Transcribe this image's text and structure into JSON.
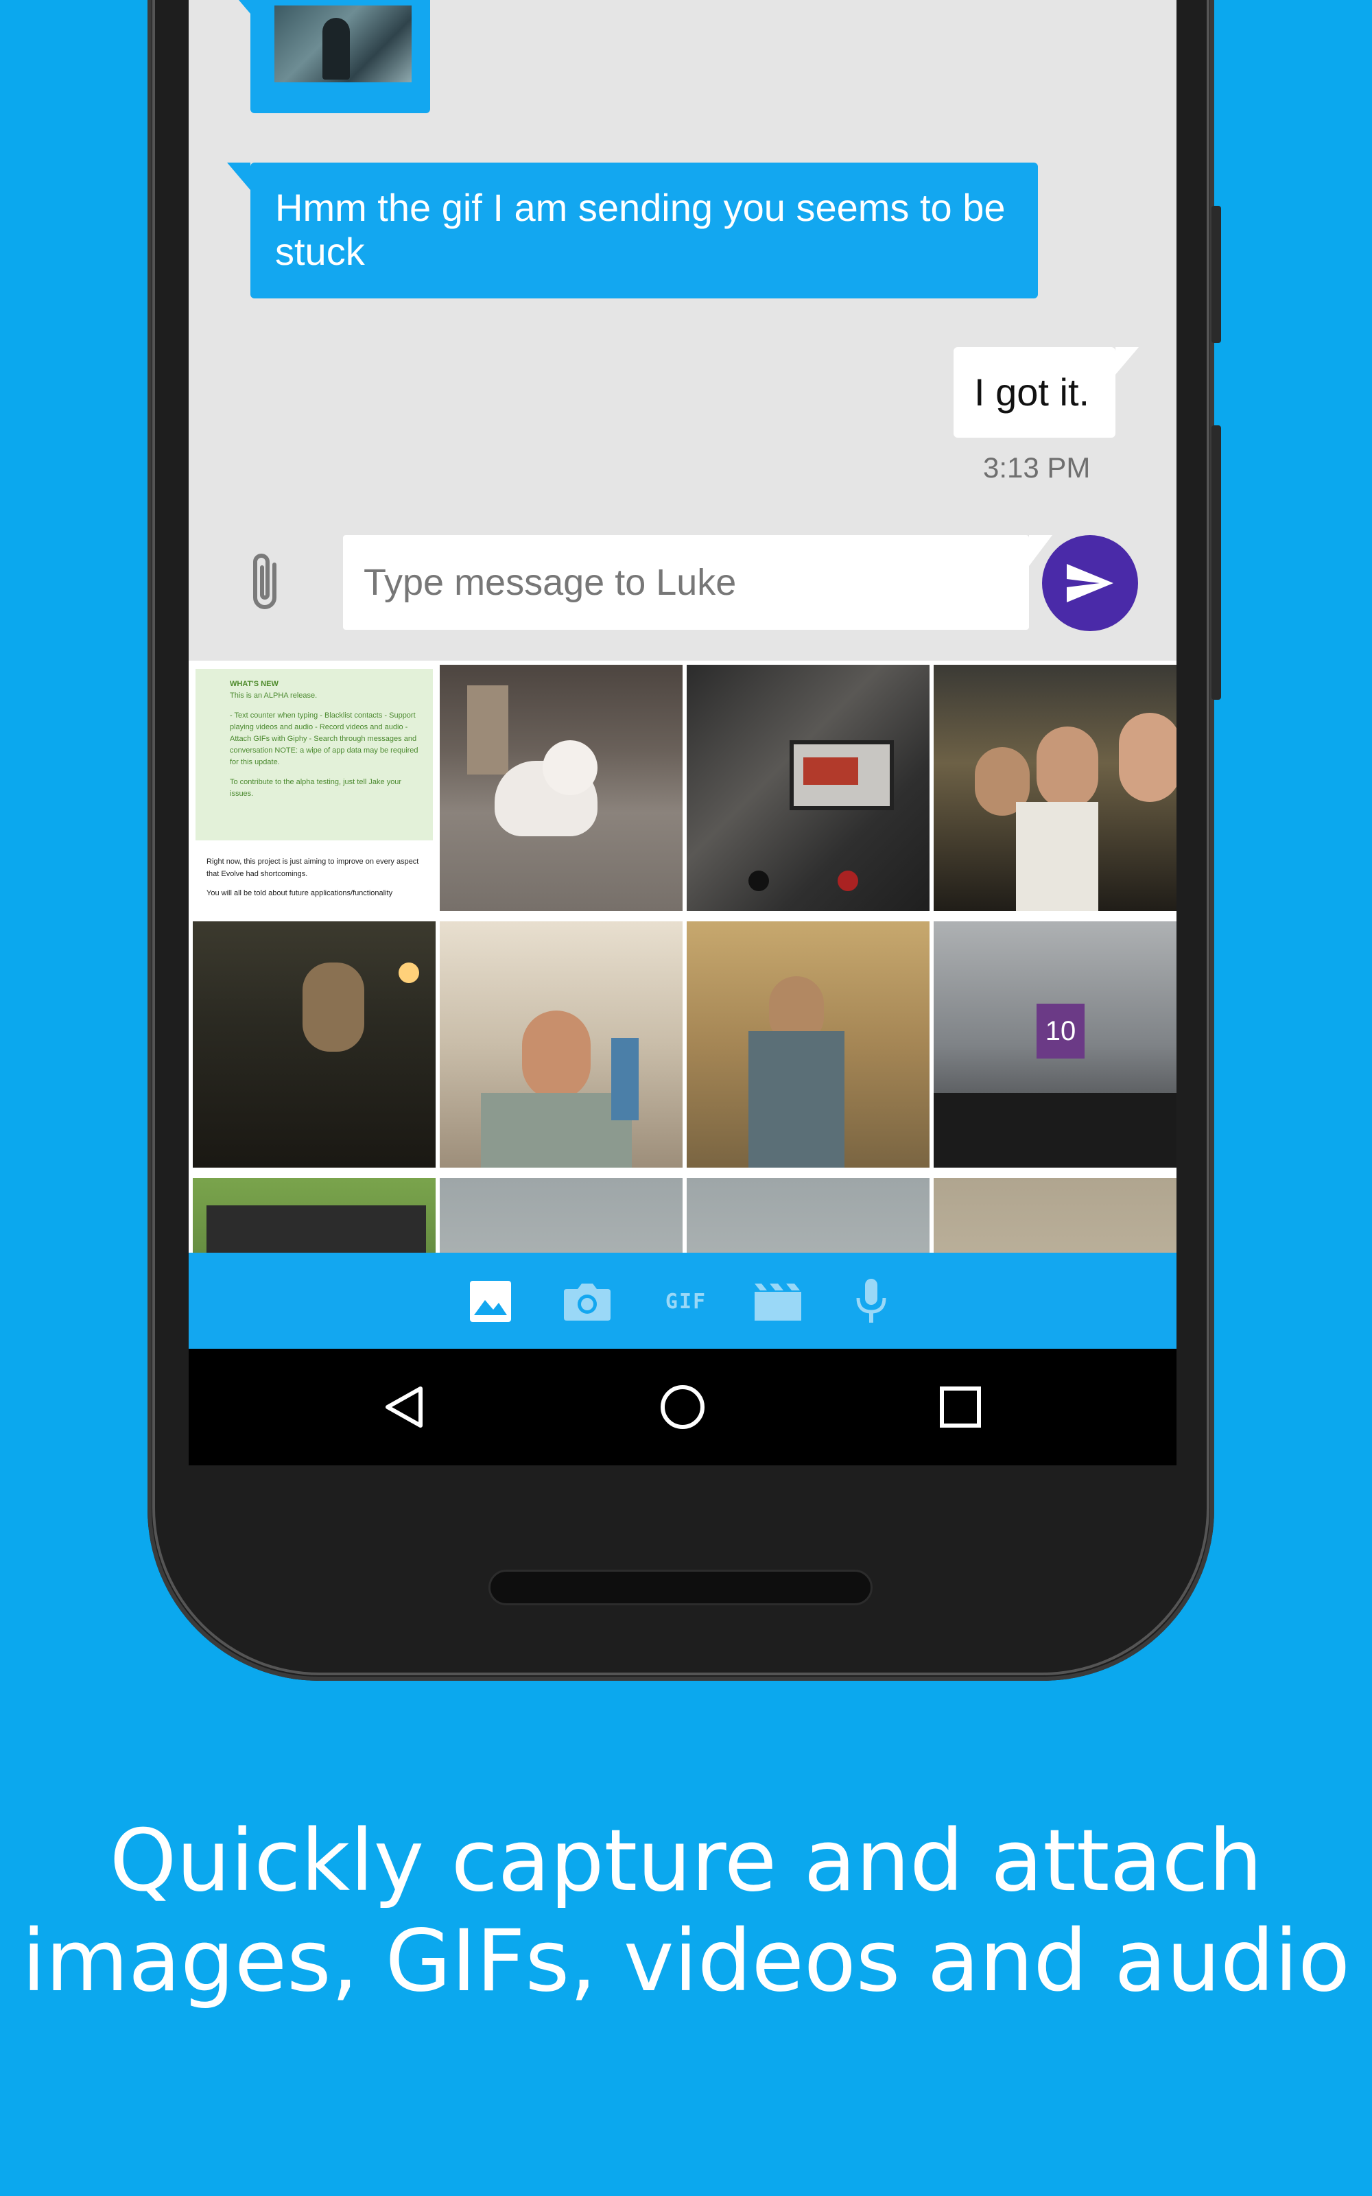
{
  "colors": {
    "background": "#0ba8ee",
    "bubble_incoming": "#13a7f0",
    "bubble_outgoing": "#ffffff",
    "send_button": "#4a2aa8",
    "attach_toolbar": "#13a7f0"
  },
  "conversation": {
    "messages": [
      {
        "direction": "incoming",
        "type": "gif",
        "text": ""
      },
      {
        "direction": "incoming",
        "type": "text",
        "text": "Hmm the gif I am sending you seems to be stuck"
      },
      {
        "direction": "outgoing",
        "type": "text",
        "text": "I got it."
      }
    ],
    "timestamp": "3:13 PM"
  },
  "composer": {
    "placeholder": "Type message to Luke",
    "attach_icon": "paperclip-icon",
    "send_icon": "send-icon"
  },
  "gallery": {
    "doc_preview": {
      "heading": "WHAT'S NEW",
      "line1": "This is an ALPHA release.",
      "body": "- Text counter when typing - Blacklist contacts - Support playing videos and audio - Record videos and audio - Attach GIFs with Giphy - Search through messages and conversation NOTE: a wipe of app data may be required for this update.",
      "contribute": "To contribute to the alpha testing, just tell Jake your issues.",
      "footer1": "Right now, this project is just aiming to improve on every aspect that Evolve had shortcomings.",
      "footer2": "You will all be told about future applications/functionality"
    },
    "parking_sign": "10"
  },
  "toolbar": {
    "gif_label": "GIF",
    "items": [
      "gallery-icon",
      "camera-icon",
      "gif-icon",
      "video-icon",
      "microphone-icon"
    ]
  },
  "navbar": {
    "items": [
      "back-icon",
      "home-icon",
      "recents-icon"
    ]
  },
  "headline": {
    "line1": "Quickly capture and attach",
    "line2": "images, GIFs, videos and audio"
  }
}
